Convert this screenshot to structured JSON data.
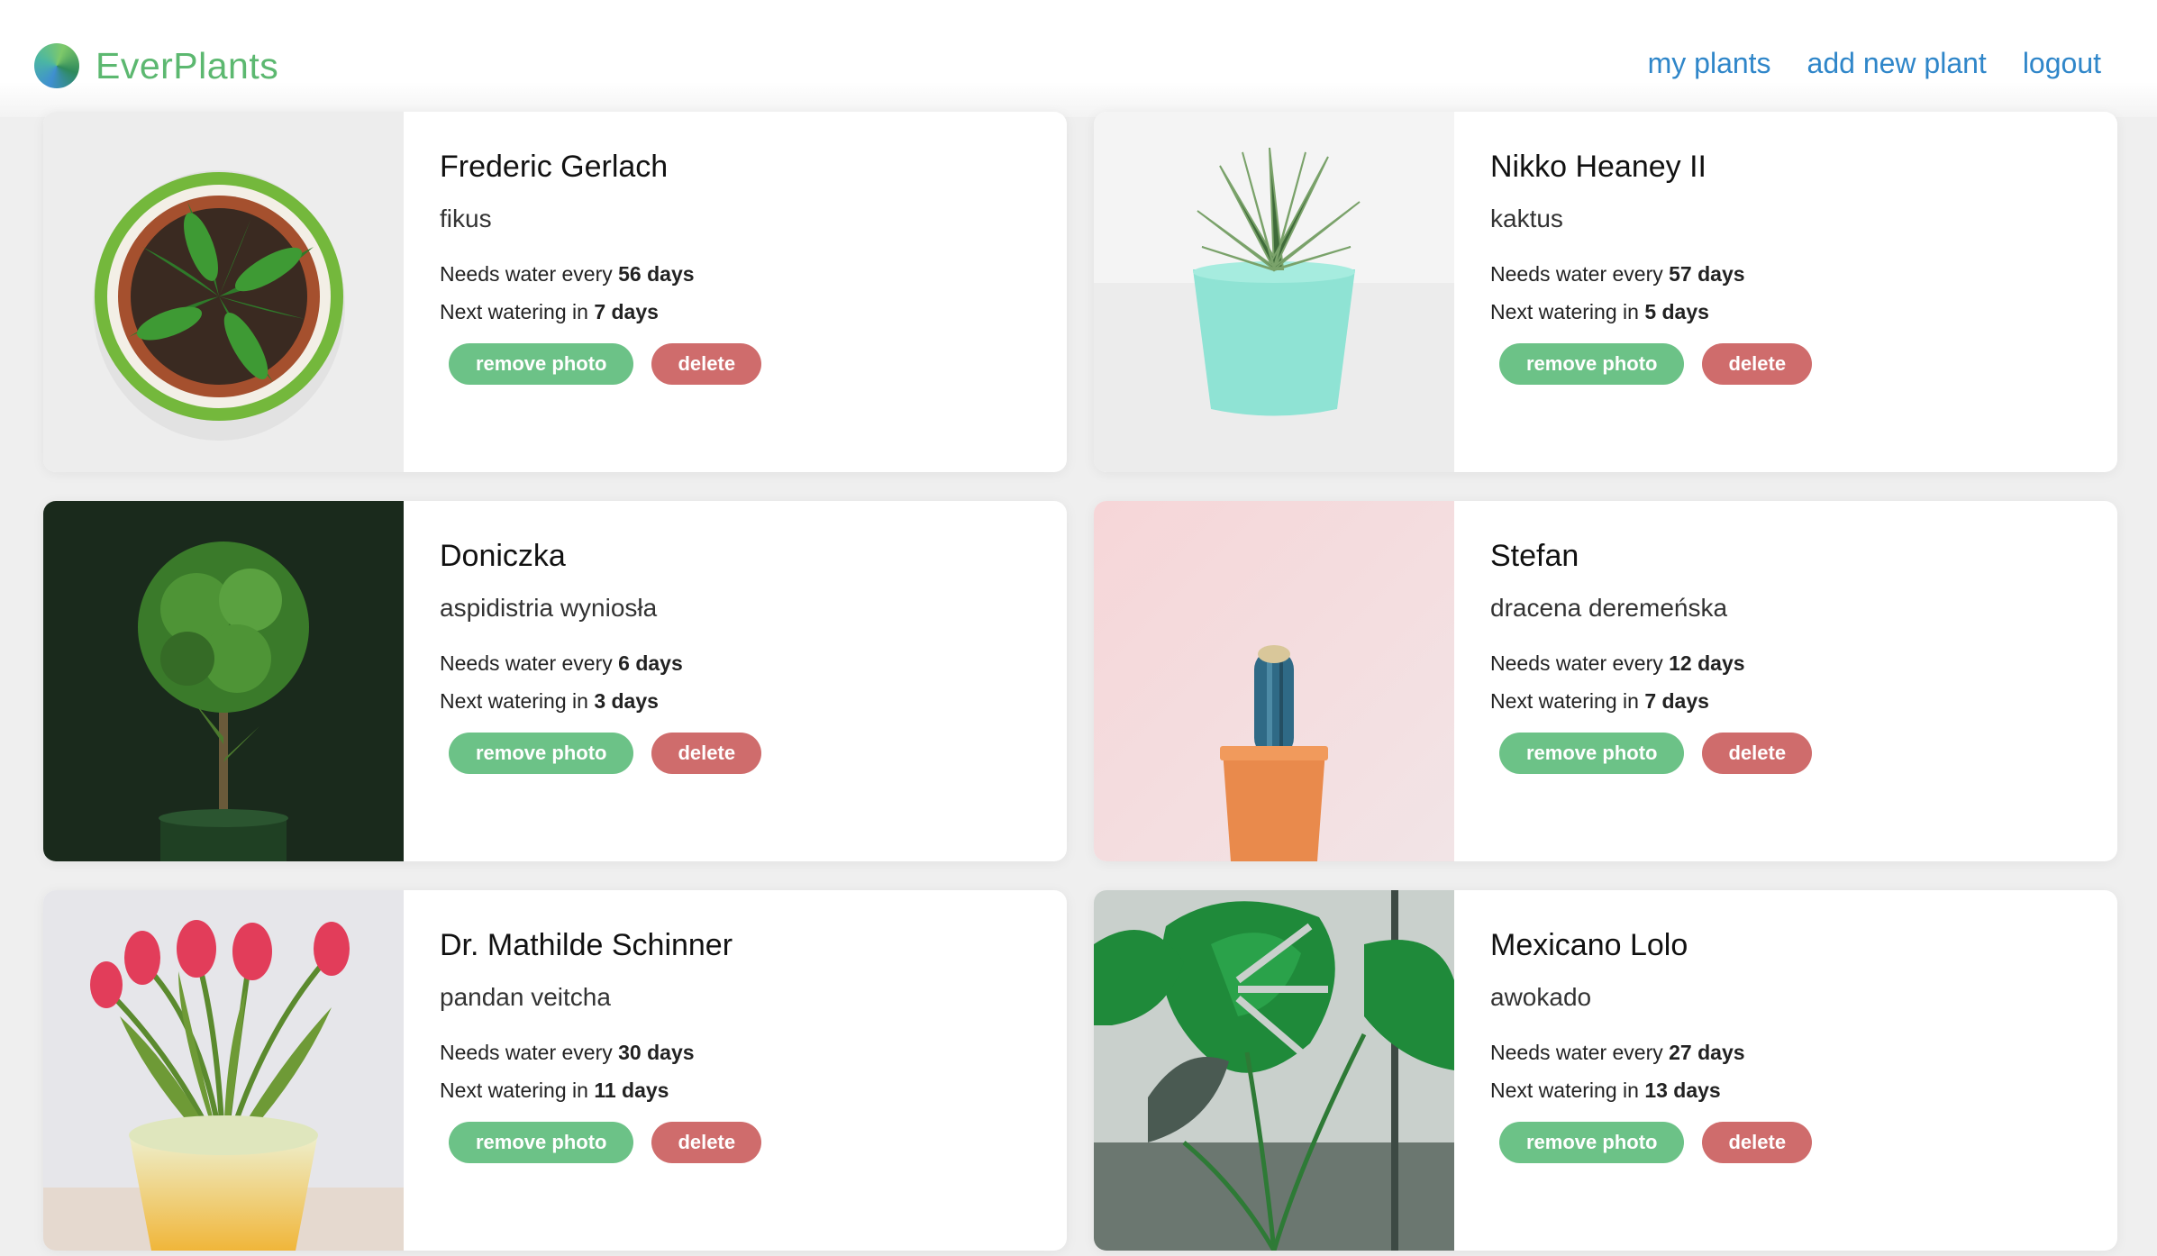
{
  "app": {
    "brand_name": "EverPlants"
  },
  "nav": {
    "items": [
      {
        "label": "my plants"
      },
      {
        "label": "add new plant"
      },
      {
        "label": "logout"
      }
    ]
  },
  "labels": {
    "needs_water_prefix": "Needs water every",
    "next_watering_prefix": "Next watering in",
    "remove_photo": "remove photo",
    "delete": "delete"
  },
  "colors": {
    "brand_green": "#5cb870",
    "nav_blue": "#2f86c9",
    "remove_button": "#6cc287",
    "delete_button": "#cf6c6c"
  },
  "plants": [
    {
      "name": "Frederic Gerlach",
      "species": "fikus",
      "water_every": "56 days",
      "next_watering": "7 days",
      "photo_icon": "potted-plant-topdown-photo"
    },
    {
      "name": "Nikko Heaney II",
      "species": "kaktus",
      "water_every": "57 days",
      "next_watering": "5 days",
      "photo_icon": "succulent-mint-pot-photo"
    },
    {
      "name": "Doniczka",
      "species": "aspidistria wyniosła",
      "water_every": "6 days",
      "next_watering": "3 days",
      "photo_icon": "topiary-tree-photo"
    },
    {
      "name": "Stefan",
      "species": "dracena deremeńska",
      "water_every": "12 days",
      "next_watering": "7 days",
      "photo_icon": "cactus-orange-pot-photo"
    },
    {
      "name": "Dr. Mathilde Schinner",
      "species": "pandan veitcha",
      "water_every": "30 days",
      "next_watering": "11 days",
      "photo_icon": "tulips-yellow-pot-photo"
    },
    {
      "name": "Mexicano Lolo",
      "species": "awokado",
      "water_every": "27 days",
      "next_watering": "13 days",
      "photo_icon": "monstera-leaves-photo"
    }
  ]
}
